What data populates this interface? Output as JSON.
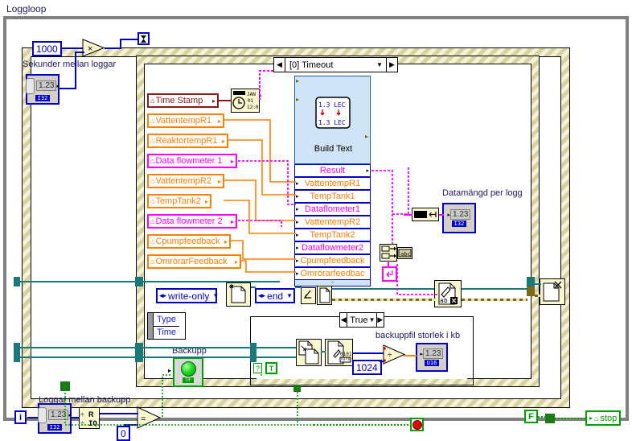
{
  "window": {
    "title": "Loggloop"
  },
  "structures": {
    "event_case": "[0] Timeout",
    "backup_case": "True"
  },
  "labels": {
    "seconds_between_logs": "Sekunder mellan loggar",
    "data_amount_per_log": "Datamängd per logg",
    "backup_file_size_kb": "backuppfil storlek i kb",
    "logs_between_backup": "Loggar mellan backupp",
    "backup": "Backupp"
  },
  "constants": {
    "multiply_const": "1000",
    "kb_divisor": "1024",
    "zero": "0",
    "false_const": "F",
    "true_const": "T",
    "question": "?",
    "iteration": "i"
  },
  "controls": {
    "numeric_value": "1.23",
    "rep_i32": "I32",
    "rep_u16": "U16",
    "rep_tf": "TF"
  },
  "rings": {
    "access_mode": "write-only",
    "position_mode": "end"
  },
  "terminals": [
    {
      "name": "Time Stamp",
      "color": "dred"
    },
    {
      "name": "VattentempR1",
      "color": "orange"
    },
    {
      "name": "ReaktortempR1",
      "color": "orange"
    },
    {
      "name": "Data flowmeter 1",
      "color": "magenta"
    },
    {
      "name": "VattentempR2",
      "color": "orange"
    },
    {
      "name": "TempTank2",
      "color": "orange"
    },
    {
      "name": "Data flowmeter 2",
      "color": "magenta"
    },
    {
      "name": "Cpumpfeedback",
      "color": "orange"
    },
    {
      "name": "OmrörarFeedback",
      "color": "orange"
    }
  ],
  "build_text": {
    "title": "Build Text",
    "result_label": "Result",
    "inputs": [
      {
        "name": "VattentempR1",
        "color": "orange"
      },
      {
        "name": "TempTank1",
        "color": "orange"
      },
      {
        "name": "Dataflometer1",
        "color": "magenta"
      },
      {
        "name": "VattentempR2",
        "color": "orange"
      },
      {
        "name": "TempTank2",
        "color": "orange"
      },
      {
        "name": "Dataflowmeter2",
        "color": "magenta"
      },
      {
        "name": "Cpumpfeedback",
        "color": "orange"
      },
      {
        "name": "Omrörarfeedbac",
        "color": "orange"
      }
    ]
  },
  "cluster": {
    "rows": [
      "Type",
      "Time"
    ]
  },
  "stop": {
    "label": "stop"
  },
  "colors": {
    "wire_orange": "#ff7f00",
    "wire_magenta": "#ff00ff",
    "wire_blue": "#0000c8",
    "wire_teal": "#1a7a7a",
    "wire_green": "#00a000",
    "wire_yellow": "#7a6a1a",
    "struct_fill": "#f5f2d8",
    "build_text_fill": "#cfe4f7",
    "node_fill": "#fbf8d0"
  }
}
